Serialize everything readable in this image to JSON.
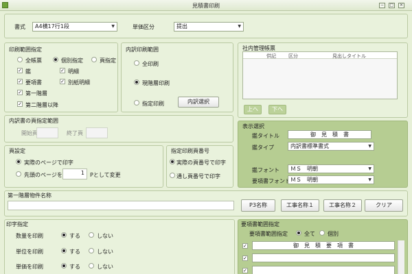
{
  "window": {
    "title": "見積書印刷"
  },
  "top": {
    "format_label": "書式",
    "format_value": "A4横17行1段",
    "price_label": "単価区分",
    "price_value": "提出"
  },
  "print_range": {
    "title": "印刷範囲指定",
    "opt_all": "全帳票",
    "opt_individual": "個別指定",
    "opt_page": "頁指定",
    "chk_cover": "鑑",
    "chk_detail": "明細",
    "chk_summary": "要項書",
    "chk_separate_detail": "別紙明細",
    "chk_level1": "第一階層",
    "chk_level2": "第二階層以降"
  },
  "breakdown": {
    "title": "内訳印刷範囲",
    "opt_all": "全印刷",
    "opt_current": "現階層印刷",
    "opt_specified": "指定印刷",
    "select_button": "内訳選択"
  },
  "internal": {
    "title": "社内管理帳票",
    "col_kind": "供記",
    "col_category": "区分",
    "col_heading": "見出しタイトル",
    "up_button": "上へ",
    "down_button": "下へ"
  },
  "page_range": {
    "title": "内訳書の頁指定範囲",
    "start_label": "開始頁",
    "end_label": "終了頁"
  },
  "page_setting": {
    "title": "頁設定",
    "opt_actual": "実際のページで印字",
    "opt_first": "先頭のページを",
    "first_value": "1",
    "suffix": "Pとして変更"
  },
  "print_page_number": {
    "title": "指定印刷頁番号",
    "opt_actual": "実際の頁番号で印字",
    "opt_serial": "通し頁番号で印字"
  },
  "display": {
    "title": "表示選択",
    "cover_title_label": "鑑タイトル",
    "cover_title_value": "御　見　積　書",
    "cover_type_label": "鑑タイプ",
    "cover_type_value": "内訳書標準書式",
    "cover_font_label": "鑑フォント",
    "cover_font_value": "ＭＳ　明朝",
    "summary_font_label": "要項書フォント",
    "summary_font_value": "ＭＳ　明朝"
  },
  "level1_name": {
    "title": "第一階層物件名称",
    "btn_p": "P3名称",
    "btn_work1": "工事名称１",
    "btn_work2": "工事名称２",
    "btn_clear": "クリア"
  },
  "print_spec": {
    "title": "印字指定",
    "row_qty": "数量を印刷",
    "row_unit": "単位を印刷",
    "row_price": "単価を印刷",
    "yes": "する",
    "no": "しない"
  },
  "summary_range": {
    "title": "要項書範囲指定",
    "spec_label": "要項書範囲指定",
    "opt_all": "全て",
    "opt_individual": "個別",
    "item_1": "御　見　積　要　項　書"
  }
}
